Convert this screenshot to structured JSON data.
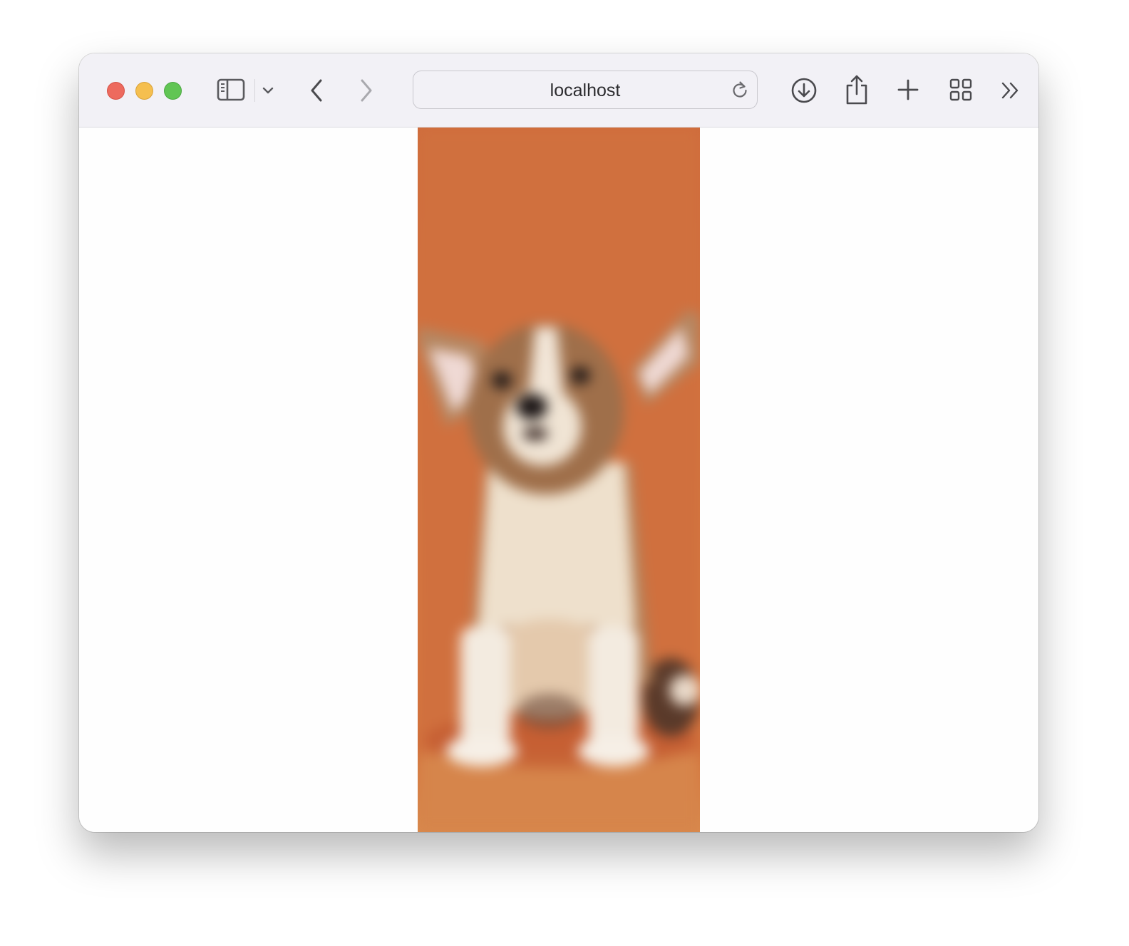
{
  "browser": {
    "address_bar": {
      "url_text": "localhost"
    },
    "icons": {
      "sidebar": "sidebar-icon",
      "sidebar_menu": "chevron-down-icon",
      "back": "chevron-left-icon",
      "forward": "chevron-right-icon",
      "reload": "reload-icon",
      "downloads": "download-icon",
      "share": "share-icon",
      "new_tab": "plus-icon",
      "tab_overview": "grid-icon",
      "more": "double-chevron-right-icon"
    },
    "colors": {
      "toolbar": "#f2f1f6",
      "close": "#ed6a5e",
      "minimize": "#f5bf4f",
      "maximize": "#61c554",
      "photo_background": "#d2733f"
    }
  },
  "page": {
    "image": {
      "subject": "puppy-photo"
    }
  }
}
